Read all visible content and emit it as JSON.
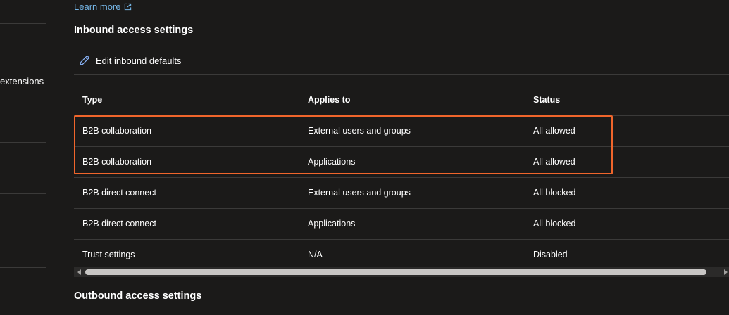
{
  "left_nav": {
    "fragments": [
      "extensions",
      "t"
    ]
  },
  "learn_more": {
    "label": "Learn more",
    "icon": "external-link-icon"
  },
  "inbound": {
    "title": "Inbound access settings",
    "toolbar": {
      "edit_label": "Edit inbound defaults",
      "edit_icon": "pencil-icon"
    },
    "table": {
      "headers": [
        "Type",
        "Applies to",
        "Status"
      ],
      "rows": [
        [
          "B2B collaboration",
          "External users and groups",
          "All allowed"
        ],
        [
          "B2B collaboration",
          "Applications",
          "All allowed"
        ],
        [
          "B2B direct connect",
          "External users and groups",
          "All blocked"
        ],
        [
          "B2B direct connect",
          "Applications",
          "All blocked"
        ],
        [
          "Trust settings",
          "N/A",
          "Disabled"
        ]
      ]
    }
  },
  "outbound": {
    "title": "Outbound access settings"
  },
  "colors": {
    "background": "#1b1a19",
    "link": "#75b6e7",
    "highlight_border": "#f0652b",
    "divider": "#3b3a39"
  }
}
